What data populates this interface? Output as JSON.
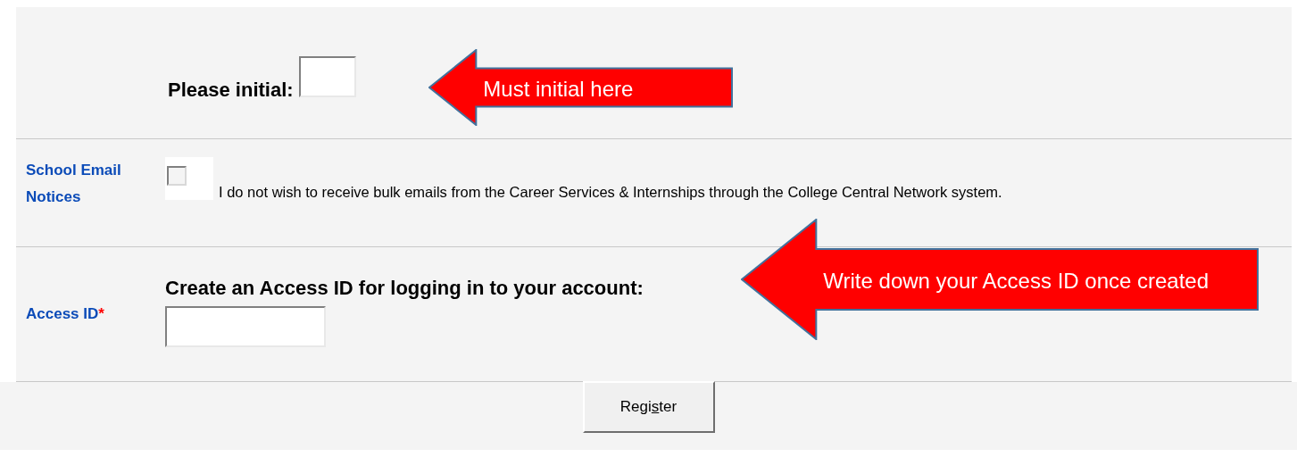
{
  "rows": [
    {
      "kind": "initial",
      "label": null,
      "prompt": "Please initial:",
      "callout": "Must initial here"
    },
    {
      "kind": "checkbox",
      "label": "School Email Notices",
      "checked": false,
      "text": "I do not wish to receive bulk emails from the Career Services & Internships through the College Central Network system."
    },
    {
      "kind": "access",
      "label": "Access ID",
      "required_mark": "*",
      "prompt": "Create an Access ID for logging in to your account:",
      "callout": "Write down your Access ID once created"
    }
  ],
  "register_button": {
    "label_before": "Regi",
    "access_key": "s",
    "label_after": "ter"
  }
}
